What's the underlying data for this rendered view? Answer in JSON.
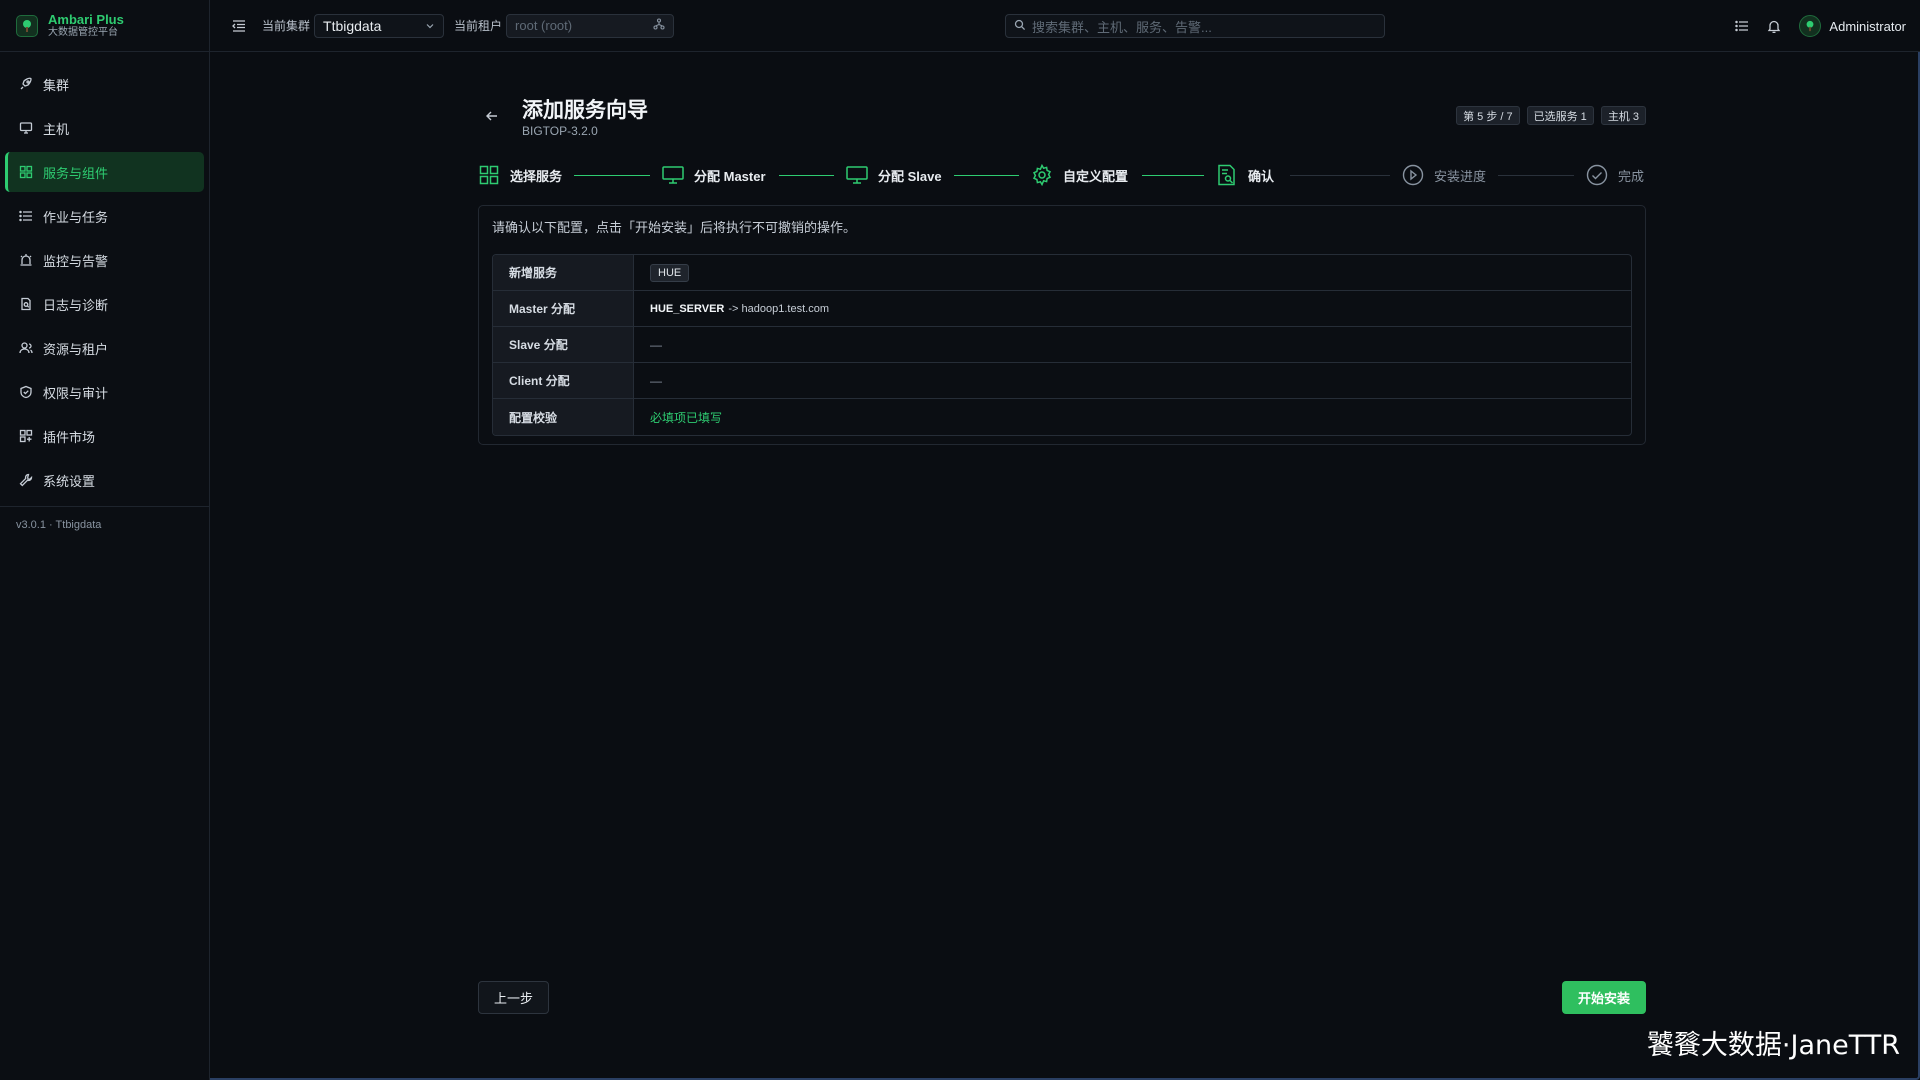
{
  "brand": {
    "title": "Ambari Plus",
    "subtitle": "大数据管控平台"
  },
  "sidebar": {
    "items": [
      {
        "label": "集群",
        "icon": "rocket-icon"
      },
      {
        "label": "主机",
        "icon": "monitor-icon"
      },
      {
        "label": "服务与组件",
        "icon": "grid-icon",
        "active": true
      },
      {
        "label": "作业与任务",
        "icon": "list-icon"
      },
      {
        "label": "监控与告警",
        "icon": "alarm-icon"
      },
      {
        "label": "日志与诊断",
        "icon": "file-search-icon"
      },
      {
        "label": "资源与租户",
        "icon": "users-icon"
      },
      {
        "label": "权限与审计",
        "icon": "shield-icon"
      },
      {
        "label": "插件市场",
        "icon": "puzzle-icon"
      },
      {
        "label": "系统设置",
        "icon": "wrench-icon"
      }
    ],
    "version": "v3.0.1 · Ttbigdata"
  },
  "topbar": {
    "cluster_label": "当前集群",
    "cluster_value": "Ttbigdata",
    "tenant_label": "当前租户",
    "tenant_placeholder": "root (root)",
    "search_placeholder": "搜索集群、主机、服务、告警...",
    "user": "Administrator"
  },
  "page": {
    "title": "添加服务向导",
    "subtitle": "BIGTOP-3.2.0",
    "badges": [
      "第 5 步 / 7",
      "已选服务 1",
      "主机 3"
    ]
  },
  "steps": [
    {
      "label": "选择服务",
      "state": "done"
    },
    {
      "label": "分配 Master",
      "state": "done"
    },
    {
      "label": "分配 Slave",
      "state": "done"
    },
    {
      "label": "自定义配置",
      "state": "done"
    },
    {
      "label": "确认",
      "state": "current"
    },
    {
      "label": "安装进度",
      "state": "pending"
    },
    {
      "label": "完成",
      "state": "pending"
    }
  ],
  "confirm": {
    "notice": "请确认以下配置，点击「开始安装」后将执行不可撤销的操作。",
    "rows": [
      {
        "key": "新增服务",
        "value": "HUE"
      },
      {
        "key": "Master 分配",
        "component": "HUE_SERVER",
        "arrow_host": "-> hadoop1.test.com"
      },
      {
        "key": "Slave 分配",
        "value": "—"
      },
      {
        "key": "Client 分配",
        "value": "—"
      },
      {
        "key": "配置校验",
        "value": "必填项已填写"
      }
    ]
  },
  "actions": {
    "prev": "上一步",
    "install": "开始安装"
  },
  "watermark": "饕餮大数据·JaneTTR",
  "colors": {
    "accent": "#2ecc71",
    "background": "#0a0d12",
    "install_button": "#2fbf5f"
  }
}
